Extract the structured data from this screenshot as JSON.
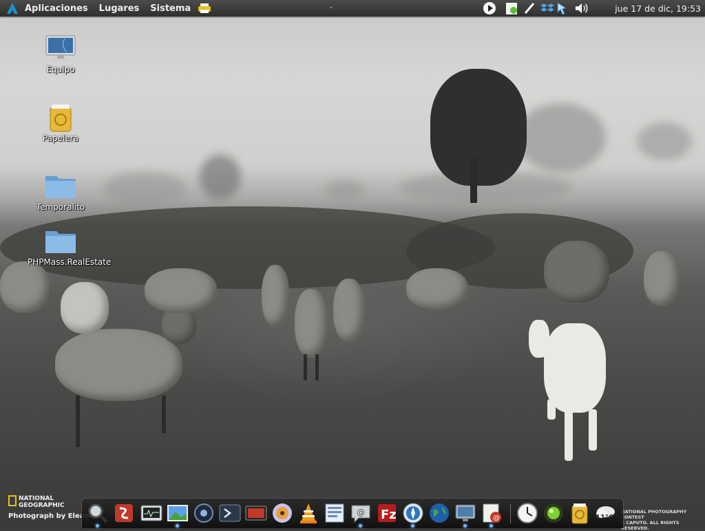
{
  "top_panel": {
    "menus": [
      "Aplicaciones",
      "Lugares",
      "Sistema"
    ],
    "clock": "jue 17 de dic, 19:53"
  },
  "desktop": {
    "icons": [
      {
        "label": "Equipo",
        "icon": "computer-icon"
      },
      {
        "label": "Papelera",
        "icon": "trash-icon"
      },
      {
        "label": "Temporalito",
        "icon": "folder-icon"
      },
      {
        "label": "PHPMass.RealEstate",
        "icon": "folder-icon"
      }
    ]
  },
  "wallpaper": {
    "brand_line1": "NATIONAL",
    "brand_line2": "GEOGRAPHIC",
    "credit": "Photograph by Eleanor",
    "contest_line1": "NATIONAL PHOTOGRAPHY CONTEST",
    "contest_line2": "R CAPUTO. ALL RIGHTS RESERVED."
  },
  "dock": {
    "weather_temp": "11°C",
    "items": [
      "search-tool-icon",
      "presentation-app-icon",
      "system-monitor-icon",
      "image-viewer-icon",
      "music-player-icon",
      "terminal-icon",
      "video-app-icon",
      "disc-burner-icon",
      "vlc-icon",
      "file-manager-icon",
      "chat-icon",
      "filezilla-icon",
      "web-browser-icon",
      "network-globe-icon",
      "remote-desktop-icon",
      "mail-icon",
      "clock-icon",
      "green-orb-icon",
      "trash-icon",
      "weather-icon"
    ]
  },
  "colors": {
    "panel_bg": "#3d3d3b",
    "dock_indicator": "#6fb7ff",
    "brand_yellow": "#e8c21b"
  }
}
